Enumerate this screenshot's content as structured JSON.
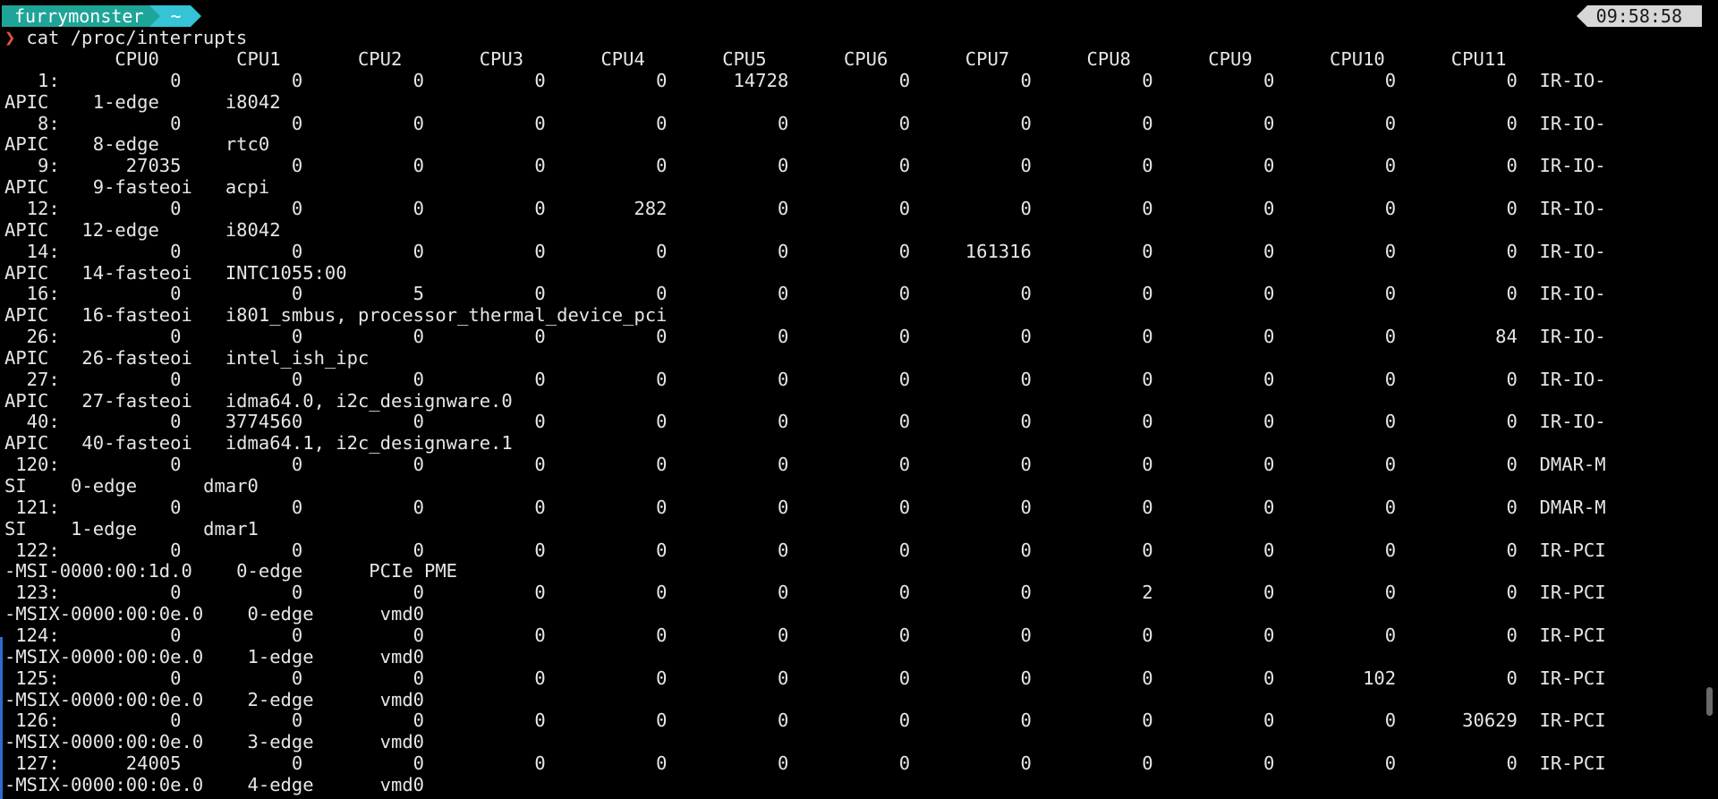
{
  "prompt": {
    "user": "furrymonster",
    "directory": "~",
    "clock": "09:58:58",
    "symbol": "❯",
    "command": "cat /proc/interrupts"
  },
  "output_lines": [
    "          CPU0       CPU1       CPU2       CPU3       CPU4       CPU5       CPU6       CPU7       CPU8       CPU9       CPU10      CPU11",
    "   1:          0          0          0          0          0      14728          0          0          0          0          0          0  IR-IO-",
    "APIC    1-edge      i8042",
    "   8:          0          0          0          0          0          0          0          0          0          0          0          0  IR-IO-",
    "APIC    8-edge      rtc0",
    "   9:      27035          0          0          0          0          0          0          0          0          0          0          0  IR-IO-",
    "APIC    9-fasteoi   acpi",
    "  12:          0          0          0          0        282          0          0          0          0          0          0          0  IR-IO-",
    "APIC   12-edge      i8042",
    "  14:          0          0          0          0          0          0          0     161316          0          0          0          0  IR-IO-",
    "APIC   14-fasteoi   INTC1055:00",
    "  16:          0          0          5          0          0          0          0          0          0          0          0          0  IR-IO-",
    "APIC   16-fasteoi   i801_smbus, processor_thermal_device_pci",
    "  26:          0          0          0          0          0          0          0          0          0          0          0         84  IR-IO-",
    "APIC   26-fasteoi   intel_ish_ipc",
    "  27:          0          0          0          0          0          0          0          0          0          0          0          0  IR-IO-",
    "APIC   27-fasteoi   idma64.0, i2c_designware.0",
    "  40:          0    3774560          0          0          0          0          0          0          0          0          0          0  IR-IO-",
    "APIC   40-fasteoi   idma64.1, i2c_designware.1",
    " 120:          0          0          0          0          0          0          0          0          0          0          0          0  DMAR-M",
    "SI    0-edge      dmar0",
    " 121:          0          0          0          0          0          0          0          0          0          0          0          0  DMAR-M",
    "SI    1-edge      dmar1",
    " 122:          0          0          0          0          0          0          0          0          0          0          0          0  IR-PCI",
    "-MSI-0000:00:1d.0    0-edge      PCIe PME",
    " 123:          0          0          0          0          0          0          0          0          2          0          0          0  IR-PCI",
    "-MSIX-0000:00:0e.0    0-edge      vmd0",
    " 124:          0          0          0          0          0          0          0          0          0          0          0          0  IR-PCI",
    "-MSIX-0000:00:0e.0    1-edge      vmd0",
    " 125:          0          0          0          0          0          0          0          0          0          0        102          0  IR-PCI",
    "-MSIX-0000:00:0e.0    2-edge      vmd0",
    " 126:          0          0          0          0          0          0          0          0          0          0          0      30629  IR-PCI",
    "-MSIX-0000:00:0e.0    3-edge      vmd0",
    " 127:      24005          0          0          0          0          0          0          0          0          0          0          0  IR-PCI",
    "-MSIX-0000:00:0e.0    4-edge      vmd0"
  ]
}
